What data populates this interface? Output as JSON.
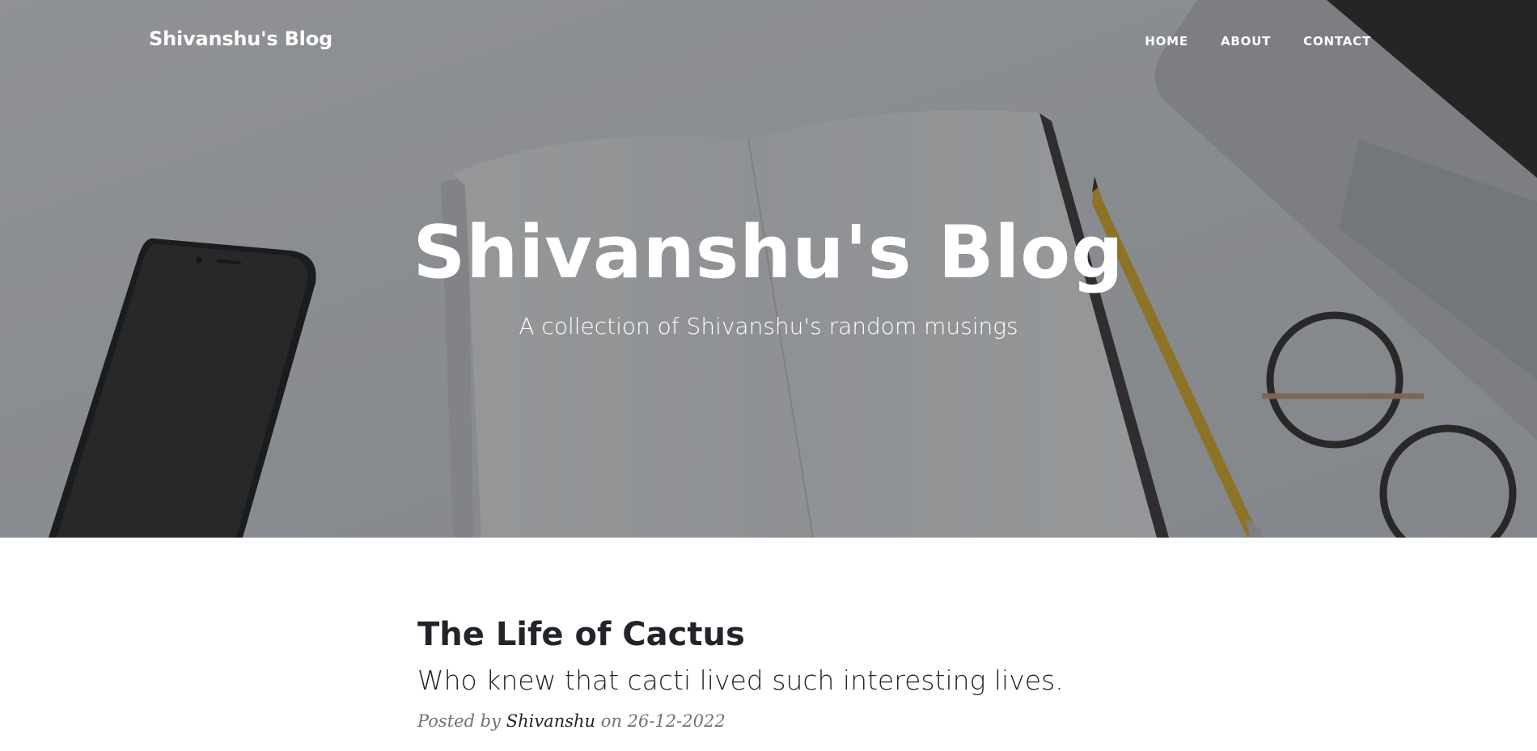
{
  "navbar": {
    "brand": "Shivanshu's Blog",
    "links": [
      {
        "label": "HOME"
      },
      {
        "label": "ABOUT"
      },
      {
        "label": "CONTACT"
      }
    ]
  },
  "hero": {
    "title": "Shivanshu's Blog",
    "subtitle": "A collection of Shivanshu's random musings"
  },
  "post": {
    "title": "The Life of Cactus",
    "subtitle": "Who knew that cacti lived such interesting lives.",
    "meta_prefix": "Posted by",
    "author": "Shivanshu",
    "meta_on": "on",
    "date": "26-12-2022"
  },
  "colors": {
    "text_dark": "#212529",
    "text_muted": "#6c757d",
    "overlay": "#212529"
  }
}
